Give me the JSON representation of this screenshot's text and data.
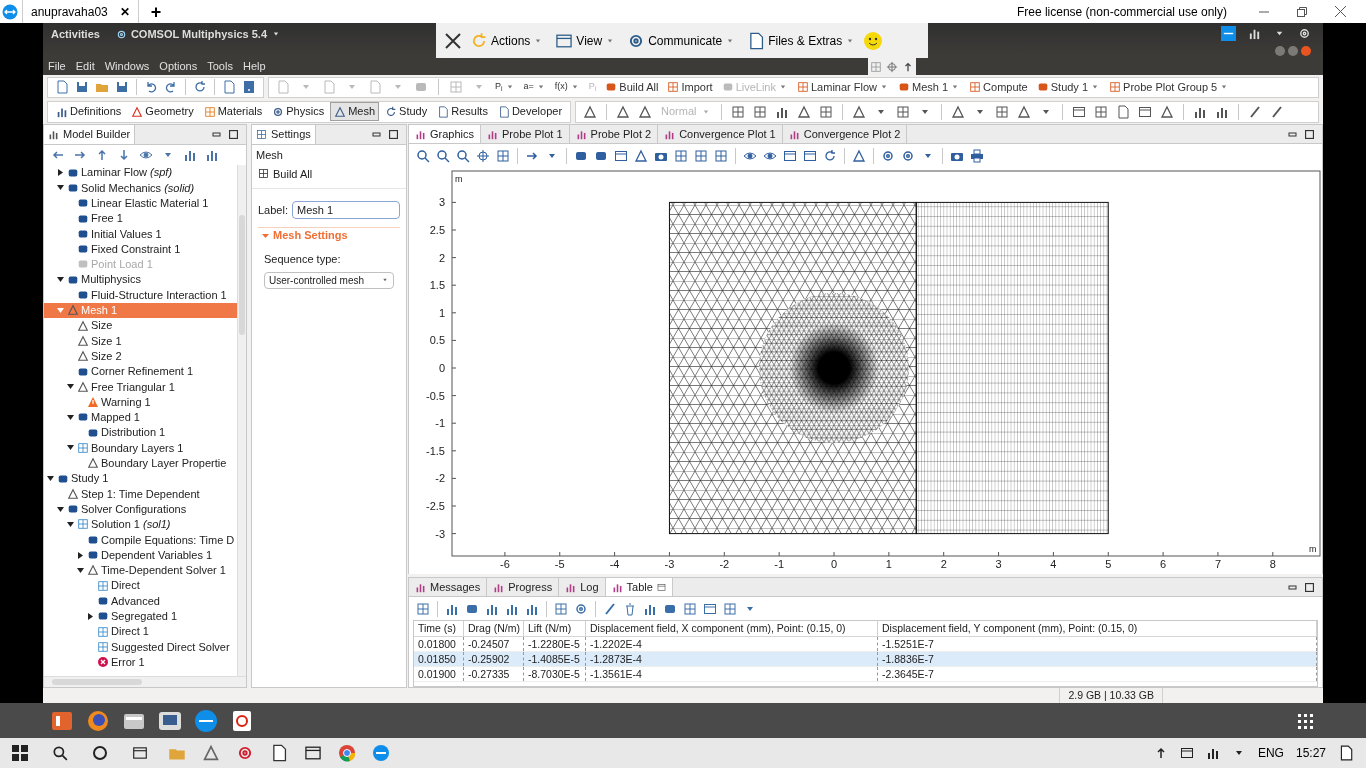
{
  "remote_tab": {
    "title": "anupravaha03",
    "close": "✕",
    "new_tab": "+"
  },
  "license_notice": "Free license (non-commercial use only)",
  "top_bar": {
    "activities": "Activities",
    "app_name": "COMSOL Multiphysics 5.4"
  },
  "teamviewer_toolbar": [
    "Actions",
    "View",
    "Communicate",
    "Files & Extras"
  ],
  "menu": [
    "File",
    "Edit",
    "Windows",
    "Options",
    "Tools",
    "Help"
  ],
  "main_toolbar": [
    {
      "label": "P$_{i}$",
      "kind": "symbol",
      "dropdown": true,
      "disabled": false
    },
    {
      "label": "a=",
      "kind": "symbol",
      "dropdown": true,
      "disabled": false
    },
    {
      "label": "f(x)",
      "kind": "symbol",
      "dropdown": true,
      "disabled": false
    },
    {
      "label": "P$_{i}$",
      "kind": "symbol",
      "dropdown": false,
      "disabled": true
    },
    {
      "label": "Build All",
      "kind": "button",
      "dropdown": false,
      "disabled": false
    },
    {
      "label": "Import",
      "kind": "button",
      "dropdown": false,
      "disabled": false
    },
    {
      "label": "LiveLink",
      "kind": "button",
      "dropdown": true,
      "disabled": true
    },
    {
      "label": "Laminar Flow",
      "kind": "button",
      "dropdown": true,
      "disabled": false
    },
    {
      "label": "Mesh 1",
      "kind": "button",
      "dropdown": true,
      "disabled": false
    },
    {
      "label": "Compute",
      "kind": "button",
      "dropdown": false,
      "disabled": false
    },
    {
      "label": "Study 1",
      "kind": "button",
      "dropdown": true,
      "disabled": false
    },
    {
      "label": "Probe Plot Group 5",
      "kind": "button",
      "dropdown": true,
      "disabled": false
    }
  ],
  "ribbon": [
    {
      "label": "Definitions",
      "selected": false
    },
    {
      "label": "Geometry",
      "selected": false
    },
    {
      "label": "Materials",
      "selected": false
    },
    {
      "label": "Physics",
      "selected": false
    },
    {
      "label": "Mesh",
      "selected": true
    },
    {
      "label": "Study",
      "selected": false
    },
    {
      "label": "Results",
      "selected": false
    },
    {
      "label": "Developer",
      "selected": false
    }
  ],
  "ribbon_mode": {
    "label": "Normal",
    "disabled": true
  },
  "model_builder": {
    "title": "Model Builder",
    "component_children": [
      {
        "label": "Laminar Flow *(spf)*",
        "kind": "feature",
        "expanded": false,
        "selected": false
      },
      {
        "label": "Solid Mechanics *(solid)*",
        "kind": "feature",
        "expanded": true,
        "selected": false,
        "children": [
          {
            "label": "Linear Elastic Material 1",
            "kind": "feature",
            "selected": false
          },
          {
            "label": "Free 1",
            "kind": "feature",
            "selected": false
          },
          {
            "label": "Initial Values 1",
            "kind": "feature",
            "selected": false
          },
          {
            "label": "Fixed Constraint 1",
            "kind": "feature",
            "selected": false
          },
          {
            "label": "Point Load 1",
            "kind": "disabled",
            "selected": false
          }
        ]
      },
      {
        "label": "Multiphysics",
        "kind": "feature",
        "expanded": true,
        "selected": false,
        "children": [
          {
            "label": "Fluid-Structure Interaction 1",
            "kind": "feature",
            "selected": false
          }
        ]
      },
      {
        "label": "Mesh 1",
        "kind": "mesh",
        "expanded": true,
        "selected": true,
        "children": [
          {
            "label": "Size",
            "kind": "mesh",
            "selected": false
          },
          {
            "label": "Size 1",
            "kind": "mesh",
            "selected": false
          },
          {
            "label": "Size 2",
            "kind": "mesh",
            "selected": false
          },
          {
            "label": "Corner Refinement 1",
            "kind": "feature",
            "selected": false
          },
          {
            "label": "Free Triangular 1",
            "kind": "mesh",
            "expanded": true,
            "selected": false,
            "children": [
              {
                "label": "Warning 1",
                "kind": "warning",
                "selected": false
              }
            ]
          },
          {
            "label": "Mapped 1",
            "kind": "feature",
            "expanded": true,
            "selected": false,
            "children": [
              {
                "label": "Distribution 1",
                "kind": "feature",
                "selected": false
              }
            ]
          },
          {
            "label": "Boundary Layers 1",
            "kind": "solver",
            "expanded": true,
            "selected": false,
            "children": [
              {
                "label": "Boundary Layer Propertie",
                "kind": "mesh",
                "selected": false
              }
            ]
          }
        ]
      }
    ],
    "roots": [
      {
        "label": "Study 1",
        "kind": "feature",
        "expanded": true,
        "selected": false,
        "children": [
          {
            "label": "Step 1: Time Dependent",
            "kind": "mesh",
            "selected": false
          },
          {
            "label": "Solver Configurations",
            "kind": "feature",
            "expanded": true,
            "selected": false,
            "children": [
              {
                "label": "Solution 1 *(sol1)*",
                "kind": "solver",
                "expanded": true,
                "selected": false,
                "children": [
                  {
                    "label": "Compile Equations: Time D",
                    "kind": "feature",
                    "selected": false
                  },
                  {
                    "label": "Dependent Variables 1",
                    "kind": "feature",
                    "expanded": false,
                    "selected": false
                  },
                  {
                    "label": "Time-Dependent Solver 1",
                    "kind": "mesh",
                    "expanded": true,
                    "selected": false,
                    "children": [
                      {
                        "label": "Direct",
                        "kind": "solver",
                        "selected": false
                      },
                      {
                        "label": "Advanced",
                        "kind": "feature",
                        "selected": false
                      },
                      {
                        "label": "Segregated 1",
                        "kind": "feature",
                        "expanded": false,
                        "selected": false
                      },
                      {
                        "label": "Direct 1",
                        "kind": "solver",
                        "selected": false
                      },
                      {
                        "label": "Suggested Direct Solver",
                        "kind": "solver",
                        "selected": false
                      },
                      {
                        "label": "Error 1",
                        "kind": "error",
                        "selected": false
                      }
                    ]
                  }
                ]
              }
            ]
          }
        ]
      }
    ]
  },
  "settings": {
    "title": "Settings",
    "node": "Mesh",
    "build_button": "Build All",
    "label_caption": "Label:",
    "label_value": "Mesh 1",
    "section": {
      "title": "Mesh Settings",
      "expanded": true
    },
    "sequence_caption": "Sequence type:",
    "sequence_value": "User-controlled mesh"
  },
  "graphics": {
    "tabs": [
      {
        "label": "Graphics",
        "selected": true
      },
      {
        "label": "Probe Plot 1",
        "selected": false
      },
      {
        "label": "Probe Plot 2",
        "selected": false
      },
      {
        "label": "Convergence Plot 1",
        "selected": false
      },
      {
        "label": "Convergence Plot 2",
        "selected": false
      }
    ],
    "x_ticks": [
      "-6",
      "-5",
      "-4",
      "-3",
      "-2",
      "-1",
      "0",
      "1",
      "2",
      "3",
      "4",
      "5",
      "6",
      "7",
      "8"
    ],
    "y_ticks": [
      "3",
      "2.5",
      "2",
      "1.5",
      "1",
      "0.5",
      "0",
      "-0.5",
      "-1",
      "-1.5",
      "-2",
      "-2.5",
      "-3"
    ],
    "x_unit": "m",
    "y_unit": "m"
  },
  "results": {
    "tabs": [
      {
        "label": "Messages",
        "selected": false
      },
      {
        "label": "Progress",
        "selected": false
      },
      {
        "label": "Log",
        "selected": false
      },
      {
        "label": "Table",
        "selected": true
      }
    ],
    "columns": [
      "Time (s)",
      "Drag (N/m)",
      "Lift (N/m)",
      "Displacement field, X component (mm), Point: (0.15, 0)",
      "Displacement field, Y component (mm), Point: (0.15, 0)"
    ],
    "rows": [
      {
        "cells": [
          "0.01800",
          "-0.24507",
          "-1.2280E-5",
          "-1.2202E-4",
          "-1.5251E-7"
        ],
        "selected": false
      },
      {
        "cells": [
          "0.01850",
          "-0.25902",
          "-1.4085E-5",
          "-1.2873E-4",
          "-1.8836E-7"
        ],
        "selected": true
      },
      {
        "cells": [
          "0.01900",
          "-0.27335",
          "-8.7030E-5",
          "-1.3561E-4",
          "-2.3645E-7"
        ],
        "selected": false
      }
    ]
  },
  "memory": "2.9 GB | 10.33 GB",
  "taskbar": {
    "language": "ENG",
    "time": "15:27"
  }
}
